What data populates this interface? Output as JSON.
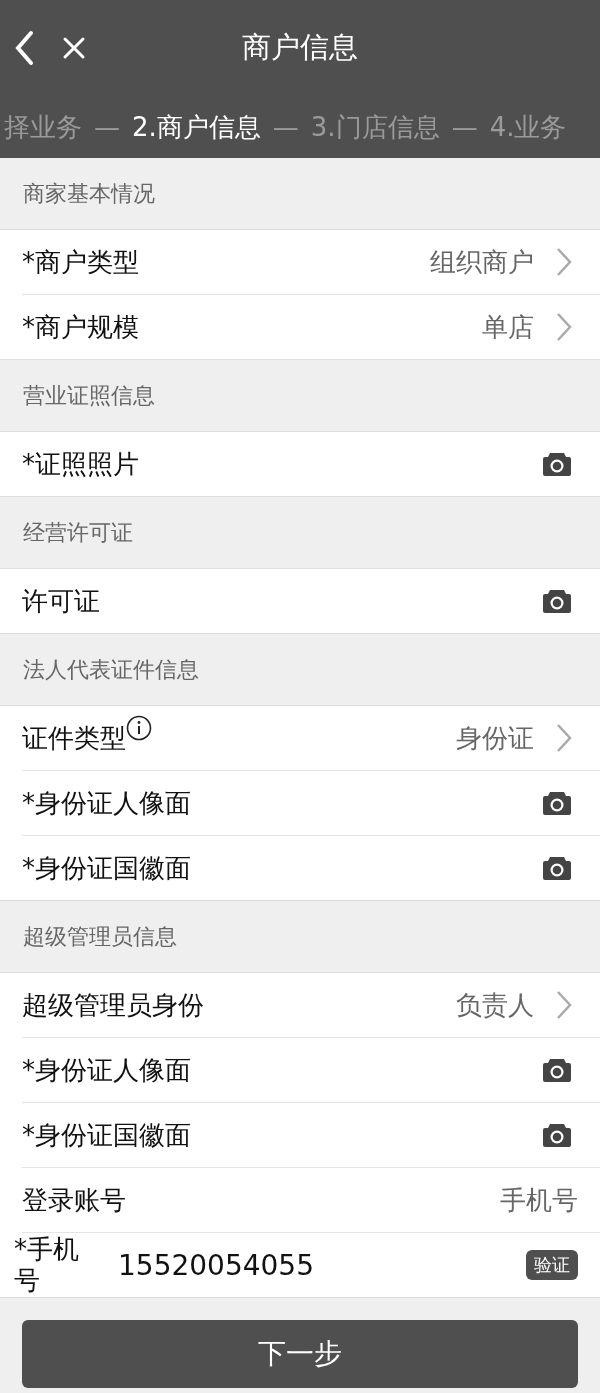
{
  "title": "商户信息",
  "steps": [
    {
      "label": "择业务",
      "selected": false
    },
    {
      "label": "2.商户信息",
      "separator": "—",
      "selected": true
    },
    {
      "label": "3.门店信息",
      "separator": "—",
      "selected": false
    },
    {
      "label": "4.业务",
      "separator": "—",
      "selected": false
    }
  ],
  "sections": [
    {
      "title": "商家基本情况",
      "rows": [
        {
          "kind": "select",
          "label": "*商户类型",
          "value": "组织商户"
        },
        {
          "kind": "select",
          "label": "*商户规模",
          "value": "单店"
        }
      ]
    },
    {
      "title": "营业证照信息",
      "rows": [
        {
          "kind": "photo",
          "label": "*证照照片"
        }
      ]
    },
    {
      "title": "经营许可证",
      "rows": [
        {
          "kind": "photo",
          "label": "许可证"
        }
      ]
    },
    {
      "title": "法人代表证件信息",
      "rows": [
        {
          "kind": "select",
          "label": "证件类型",
          "value": "身份证",
          "info": true
        },
        {
          "kind": "photo",
          "label": "*身份证人像面"
        },
        {
          "kind": "photo",
          "label": "*身份证国徽面"
        }
      ]
    },
    {
      "title": "超级管理员信息",
      "rows": [
        {
          "kind": "select",
          "label": "超级管理员身份",
          "value": "负责人"
        },
        {
          "kind": "photo",
          "label": "*身份证人像面"
        },
        {
          "kind": "photo",
          "label": "*身份证国徽面"
        },
        {
          "kind": "text",
          "label": "登录账号",
          "value": "手机号"
        },
        {
          "kind": "phone",
          "label": "*手机号",
          "value": "15520054055",
          "button": "验证"
        }
      ]
    }
  ],
  "next_button": "下一步"
}
